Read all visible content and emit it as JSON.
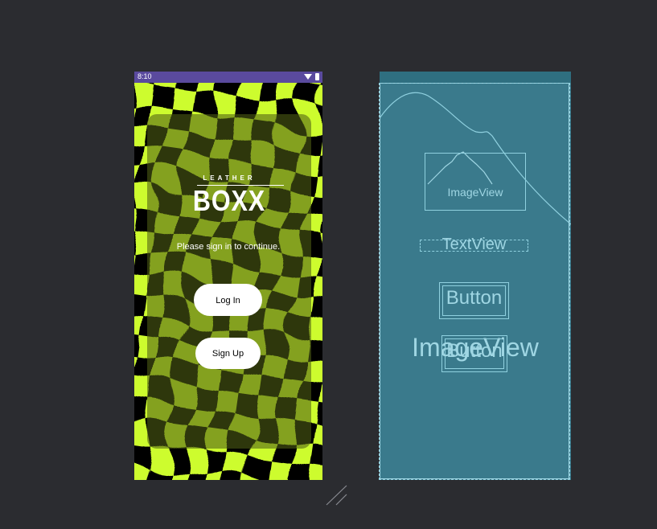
{
  "phone": {
    "status_time": "8:10",
    "icons": [
      "wifi-icon",
      "battery-icon"
    ],
    "logo_small": "LEATHER",
    "logo_big": "BOXX",
    "subtitle": "Please sign in to continue.",
    "login_label": "Log In",
    "signup_label": "Sign Up",
    "colors": {
      "accent": "#cdfc2f",
      "status_bar": "#5a4a9e",
      "card": "#505f14"
    }
  },
  "blueprint": {
    "imageview_small": "ImageView",
    "textview": "TextView",
    "button1": "Button",
    "button2": "Button",
    "imageview_big": "ImageView",
    "colors": {
      "background": "#3a7a8c",
      "lines": "#8fd0df"
    }
  },
  "canvas": {
    "background": "#2b2c30"
  }
}
